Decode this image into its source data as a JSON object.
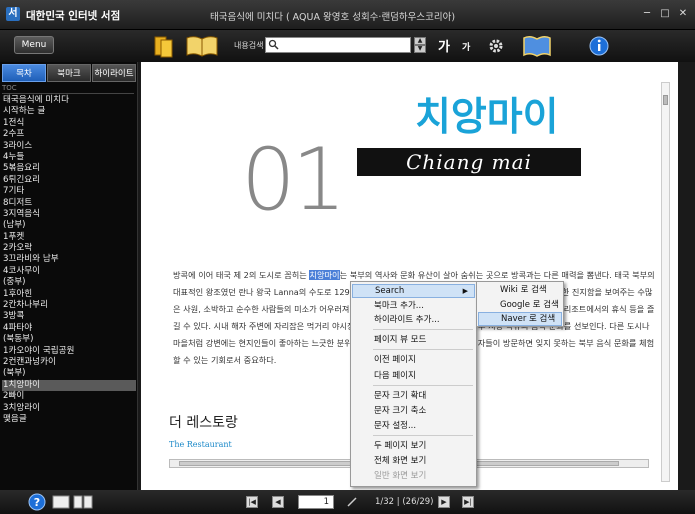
{
  "window": {
    "app_title": "대한민국 인터넷 서점",
    "doc_title": "태국음식에 미치다 ( AQUA 왕영호 성회수·랜덤하우스코리아)",
    "minimize": "─",
    "maximize": "□",
    "close": "✕"
  },
  "toolbar": {
    "menu_label": "Menu",
    "search_label": "내용검색",
    "search_value": "",
    "font_bigger": "가",
    "font_smaller": "가",
    "spin_up": "▲",
    "spin_down": "▼"
  },
  "sidebar": {
    "tabs": [
      "목차",
      "북마크",
      "하이라이트"
    ],
    "toc_header": "TOC",
    "items": [
      "태국음식에 미치다",
      "시작하는 글",
      "1전식",
      "2수프",
      "3라이스",
      "4누들",
      "5볶음요리",
      "6튀긴요리",
      "7기타",
      "8디저트",
      "3지역음식",
      "(남부)",
      "1푸켓",
      "2카오락",
      "3끄라비와 남부",
      "4코사무이",
      "(중부)",
      "1후아힌",
      "2칸차나부리",
      "3방콕",
      "4파타야",
      "(북동부)",
      "1카오야이 국립공원",
      "2컨캔과넝카이",
      "(북부)",
      "1치앙마이",
      "2빠이",
      "3치앙라이",
      "맺음글"
    ],
    "selected_index": 25
  },
  "content": {
    "big_number": "01",
    "title_ko": "치앙마이",
    "title_en": "Chiang mai",
    "para_before": "방콕에 이어 태국 제 2의 도시로 꼽히는 ",
    "para_highlight": "치앙마이",
    "para_after": "는 북부의 역사와 문화 유산이 살아 숨쉬는 곳으로 방콕과는 다른 매력을 뽐낸다. 태국 북부의 대표적인 왕조였던 란나 왕국 Lanna의 수도로 1296년 멩라이 왕이 도시를 세우면서 만든 성벽과 해자, 종교에 대한 진지함을 보여주는 수많은 사원, 소박하고 순수한 사람들의 미소가 어우러져 역사나 유적 관광 외에도 산악 지역을 트래킹하는 것이나 고급 리조트에서의 휴식 등을 즐길 수 있다. 시내 해자 주변에 자리잡은 먹거리 야시장부터 고급 레스토랑까지 다양하며 북부 지방 특유의 음식 문화를 선보인다. 다른 도시나 마을처럼 강변에는 현지인들이 좋아하는 느긋한 분위기의 로컬 식당들이 늘어서 있어 여행자들이 방문하면 잊지 못하는 북부 음식 문화를 체험할 수 있는 기회로서 중요하다.",
    "section_title": "더 레스토랑",
    "section_sub": "The Restaurant"
  },
  "context_menu": {
    "search": "Search",
    "bookmark_add": "북마크 추가...",
    "highlight_add": "하이라이트 추가...",
    "page_view_mode": "페이지 뷰 모드",
    "prev_page": "이전 페이지",
    "next_page": "다음 페이지",
    "zoom_in": "문자 크기 확대",
    "zoom_out": "문자 크기 축소",
    "text_settings": "문자 설정...",
    "two_page": "두 페이지 보기",
    "full_screen": "전체 화면 보기",
    "normal_screen": "일반 화면 보기",
    "submenu_arrow": "▶"
  },
  "submenu": {
    "wiki": "Wiki 로 검색",
    "google": "Google 로 검색",
    "naver": "Naver 로 검색"
  },
  "bottombar": {
    "page_value": "1",
    "page_info": "1/32 | (26/29)",
    "first": "|◀",
    "prev": "◀",
    "next": "▶",
    "last": "▶|",
    "help": "?"
  },
  "colors": {
    "accent_blue": "#1aa3d8",
    "highlight": "#4a7fd8",
    "menu_hover": "#cfe2f6"
  }
}
